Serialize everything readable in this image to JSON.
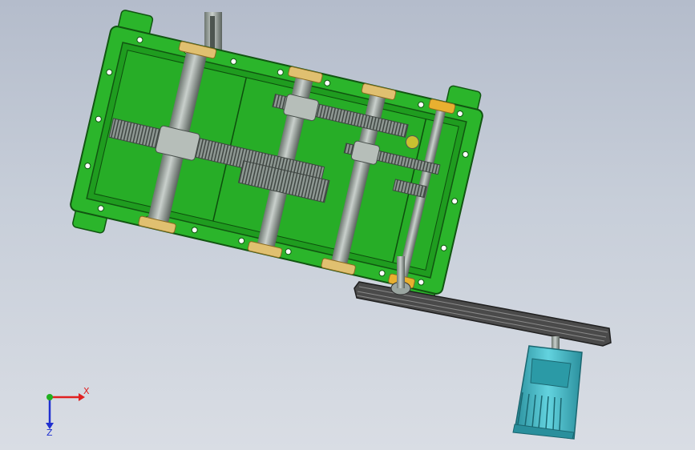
{
  "viewport": {
    "background_top": "#b4bccb",
    "background_bottom": "#d9dde4"
  },
  "model": {
    "housing_color": "#2bb52b",
    "housing_edge": "#115511",
    "gear_color": "#9aa5a0",
    "belt_color": "#3a3a3a",
    "motor_color": "#3fb8c6",
    "bearing_color": "#e0c070"
  },
  "triad": {
    "x_label": "X",
    "z_label": "Z",
    "x_color": "#e02020",
    "y_color": "#20b020",
    "z_color": "#2030d0"
  }
}
